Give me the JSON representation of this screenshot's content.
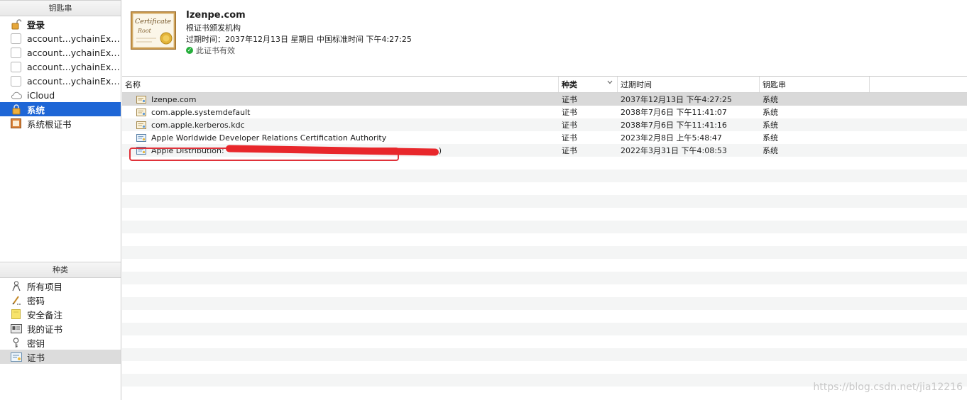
{
  "sidebar": {
    "keychains_header": "钥匙串",
    "keychains": [
      {
        "label": "登录",
        "icon": "lock-open-icon",
        "bold": true
      },
      {
        "label": "account...ychainExport",
        "icon": "blank-icon"
      },
      {
        "label": "account...ychainExport",
        "icon": "blank-icon"
      },
      {
        "label": "account...ychainExport",
        "icon": "blank-icon"
      },
      {
        "label": "account...ychainExport",
        "icon": "blank-icon"
      },
      {
        "label": "iCloud",
        "icon": "cloud-icon"
      },
      {
        "label": "系统",
        "icon": "lock-icon",
        "bold": true,
        "selected": true
      },
      {
        "label": "系统根证书",
        "icon": "cabinet-icon"
      }
    ],
    "category_header": "种类",
    "categories": [
      {
        "label": "所有项目",
        "icon": "people-icon"
      },
      {
        "label": "密码",
        "icon": "pencil-icon"
      },
      {
        "label": "安全备注",
        "icon": "note-icon"
      },
      {
        "label": "我的证书",
        "icon": "id-card-icon"
      },
      {
        "label": "密钥",
        "icon": "key-icon"
      },
      {
        "label": "证书",
        "icon": "certificate-icon",
        "selected": true
      }
    ]
  },
  "detail": {
    "title": "Izenpe.com",
    "subtitle": "根证书颁发机构",
    "expiry": "过期时间：2037年12月13日 星期日 中国标准时间 下午4:27:25",
    "valid": "此证书有效",
    "thumb_text_1": "Certificate",
    "thumb_text_2": "Root"
  },
  "table": {
    "columns": [
      "名称",
      "种类",
      "过期时间",
      "钥匙串"
    ],
    "sorted_column": "种类",
    "rows": [
      {
        "name": "Izenpe.com",
        "kind": "证书",
        "expires": "2037年12月13日 下午4:27:25",
        "keychain": "系统",
        "selected": true
      },
      {
        "name": "com.apple.systemdefault",
        "kind": "证书",
        "expires": "2038年7月6日 下午11:41:07",
        "keychain": "系统"
      },
      {
        "name": "com.apple.kerberos.kdc",
        "kind": "证书",
        "expires": "2038年7月6日 下午11:41:16",
        "keychain": "系统"
      },
      {
        "name": "Apple Worldwide Developer Relations Certification Authority",
        "kind": "证书",
        "expires": "2023年2月8日 上午5:48:47",
        "keychain": "系统",
        "highlighted": true
      },
      {
        "name": "Apple Distribution:",
        "kind": "证书",
        "expires": "2022年3月31日 下午4:08:53",
        "keychain": "系统",
        "redacted": true,
        "suffix": ")"
      }
    ]
  },
  "watermark": "https://blog.csdn.net/jia12216",
  "colors": {
    "selection_blue": "#1e66d6",
    "highlight_red": "#e0323a",
    "valid_green": "#27ae3c"
  }
}
